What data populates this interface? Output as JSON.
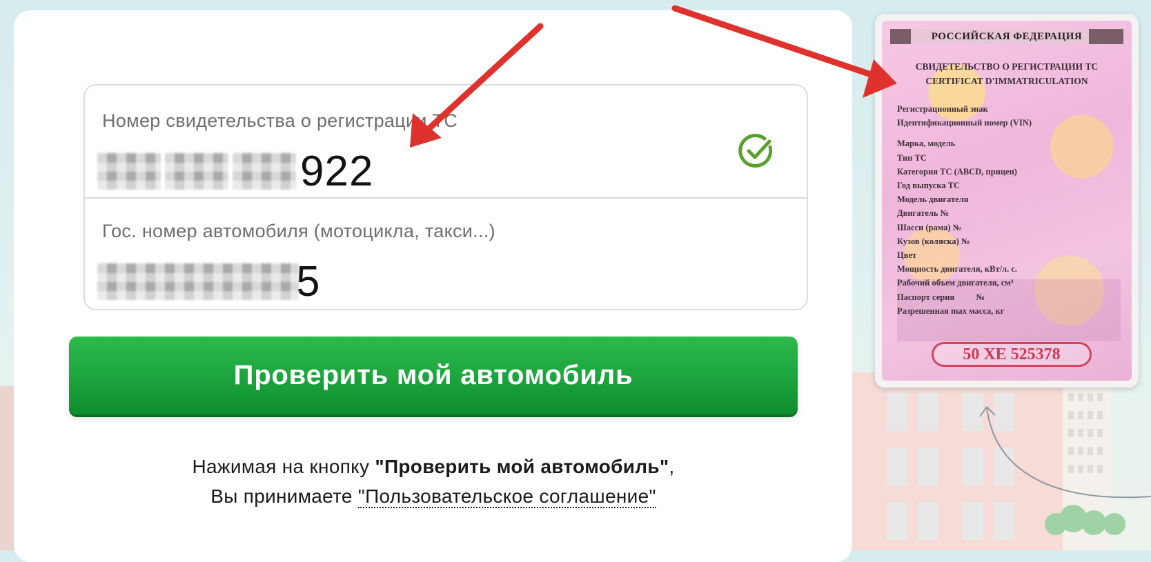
{
  "form": {
    "sts_label": "Номер свидетельства о регистрации ТС",
    "sts_value_visible": "922",
    "plate_label": "Гос. номер автомобиля (мотоцикла, такси...)",
    "plate_value_visible": "5"
  },
  "submit": {
    "label": "Проверить мой автомобиль"
  },
  "agreement": {
    "prefix": "Нажимая на кнопку ",
    "button_ref": "\"Проверить мой автомобиль\"",
    "comma": ",",
    "line2_prefix": "Вы принимаете ",
    "link_text": "\"Пользовательское соглашение\""
  },
  "certificate": {
    "country": "РОССИЙСКАЯ ФЕДЕРАЦИЯ",
    "title_ru": "СВИДЕТЕЛЬСТВО О РЕГИСТРАЦИИ ТС",
    "title_fr": "CERTIFICAT D'IMMATRICULATION",
    "lines_a": [
      "Регистрационный знак",
      "Идентификационный номер (VIN)"
    ],
    "lines_b": [
      "Марка, модель",
      "Тип ТС",
      "Категория ТС (ABCD, прицеп)",
      "Год выпуска ТС",
      "Модель двигателя",
      "Двигатель №",
      "Шасси (рама) №",
      "Кузов (коляска) №",
      "Цвет"
    ],
    "lines_c": [
      "Мощность двигателя, кВт/л. с.",
      "Рабочий объем двигателя, см³",
      "Паспорт серия          №",
      "Разрешенная max масса, кг"
    ],
    "number": "50 ХЕ 525378"
  },
  "colors": {
    "button_green": "#1da53e",
    "check_green": "#5aa02c",
    "arrow_red": "#e0322c",
    "cert_pink": "#efb7db",
    "cert_red_border": "#d2455d"
  },
  "icons": [
    "check-circle-icon",
    "red-arrow-pointer"
  ]
}
